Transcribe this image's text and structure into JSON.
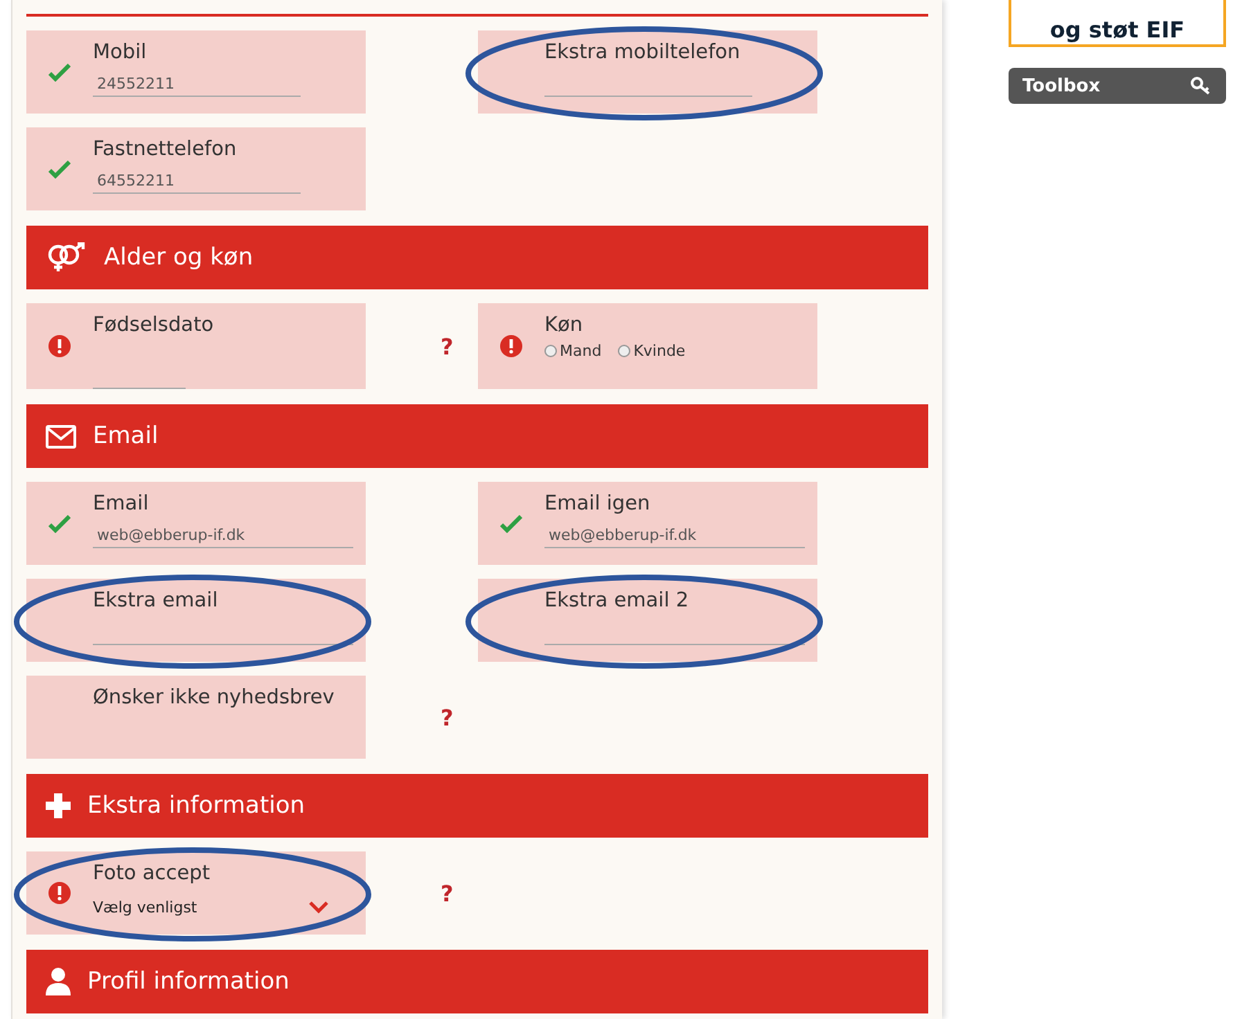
{
  "sections": [
    {
      "rows": [
        {
          "left": {
            "label": "Mobil",
            "kind": "text",
            "valid": true,
            "value": "24552211",
            "circled": false
          },
          "right": {
            "label": "Ekstra mobiltelefon",
            "kind": "text",
            "circled": true
          }
        },
        {
          "left": {
            "label": "Fastnettelefon",
            "kind": "text",
            "valid": true,
            "value": "64552211",
            "circled": false
          }
        }
      ]
    },
    {
      "kind": "gender",
      "title": "Alder og køn",
      "rows": [
        {
          "left": {
            "label": "Fødselsdato",
            "kind": "date",
            "valid": false,
            "circled": false
          },
          "help": "?",
          "right": {
            "label": "Køn",
            "kind": "radio",
            "valid": false,
            "circled": false,
            "options": [
              {
                "label": "Mand",
                "selected": false
              },
              {
                "label": "Kvinde",
                "selected": false
              }
            ]
          }
        }
      ]
    },
    {
      "kind": "email",
      "title": "Email",
      "rows": [
        {
          "left": {
            "label": "Email",
            "kind": "wide",
            "valid": true,
            "value": "web@ebberup-if.dk",
            "circled": false
          },
          "right": {
            "label": "Email igen",
            "kind": "wide",
            "valid": true,
            "value": "web@ebberup-if.dk",
            "circled": false
          }
        },
        {
          "left": {
            "label": "Ekstra email",
            "kind": "wide",
            "circled": true
          },
          "right": {
            "label": "Ekstra email 2",
            "kind": "wide",
            "circled": true
          }
        },
        {
          "left": {
            "label": "Ønsker ikke nyhedsbrev",
            "kind": "plain",
            "circled": false
          },
          "help": "?"
        }
      ]
    },
    {
      "kind": "plus",
      "title": "Ekstra information",
      "rows": [
        {
          "left": {
            "label": "Foto accept",
            "kind": "select",
            "valid": false,
            "value": "Vælg venligst",
            "circled": true
          },
          "help": "?"
        }
      ]
    },
    {
      "kind": "person",
      "title": "Profil information"
    }
  ],
  "sidebar": {
    "banner": "og støt EIF",
    "toolbox": "Toolbox"
  }
}
